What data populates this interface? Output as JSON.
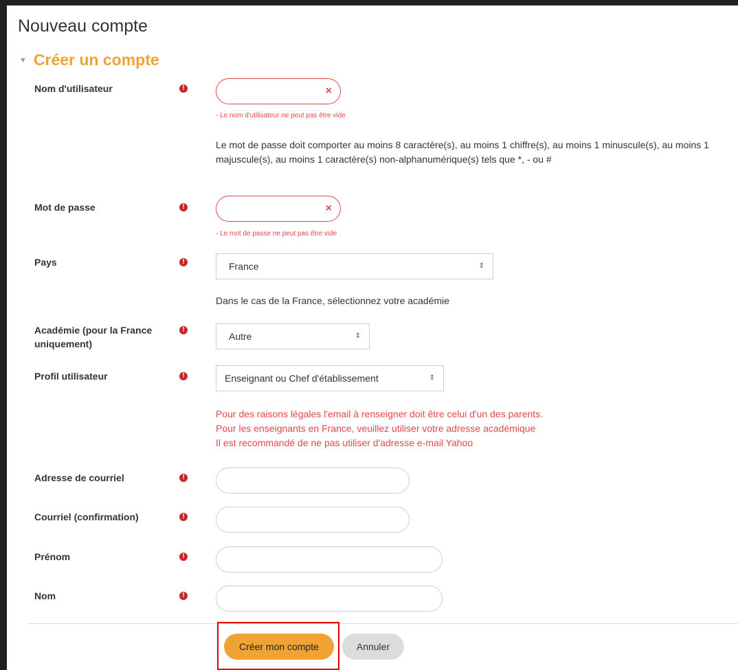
{
  "page": {
    "title": "Nouveau compte"
  },
  "section": {
    "title": "Créer un compte"
  },
  "fields": {
    "username": {
      "label": "Nom d'utilisateur",
      "value": "",
      "error": "- Le nom d'utilisateur ne peut pas être vide"
    },
    "password_rules": "Le mot de passe doit comporter au moins 8 caractère(s), au moins 1 chiffre(s), au moins 1 minuscule(s), au moins 1 majuscule(s), au moins 1 caractère(s) non-alphanumérique(s) tels que *, - ou #",
    "password": {
      "label": "Mot de passe",
      "value": "",
      "error": "- Le mot de passe ne peut pas être vide"
    },
    "country": {
      "label": "Pays",
      "selected": "France"
    },
    "academy_help": "Dans le cas de la France, sélectionnez votre académie",
    "academy": {
      "label": "Académie (pour la France uniquement)",
      "selected": "Autre"
    },
    "profile": {
      "label": "Profil utilisateur",
      "selected": "Enseignant ou Chef d'établissement"
    },
    "legal_notes": [
      "Pour des raisons légales l'email à renseigner doit être celui d'un des parents.",
      "Pour les enseignants en France, veuillez utiliser votre adresse académique",
      "Il est recommandé de ne pas utiliser d'adresse e-mail Yahoo"
    ],
    "email": {
      "label": "Adresse de courriel",
      "value": ""
    },
    "email_confirm": {
      "label": "Courriel (confirmation)",
      "value": ""
    },
    "firstname": {
      "label": "Prénom",
      "value": ""
    },
    "lastname": {
      "label": "Nom",
      "value": ""
    }
  },
  "actions": {
    "submit_label": "Créer mon compte",
    "cancel_label": "Annuler"
  },
  "colors": {
    "accent": "#f0a235",
    "error": "#e0474d",
    "required_icon": "#c62828",
    "highlight": "#e00000"
  },
  "icons": {
    "required": "exclamation-circle-icon",
    "clear": "x-icon",
    "select_arrows": "updown-arrows-icon",
    "collapse": "triangle-down-icon"
  }
}
